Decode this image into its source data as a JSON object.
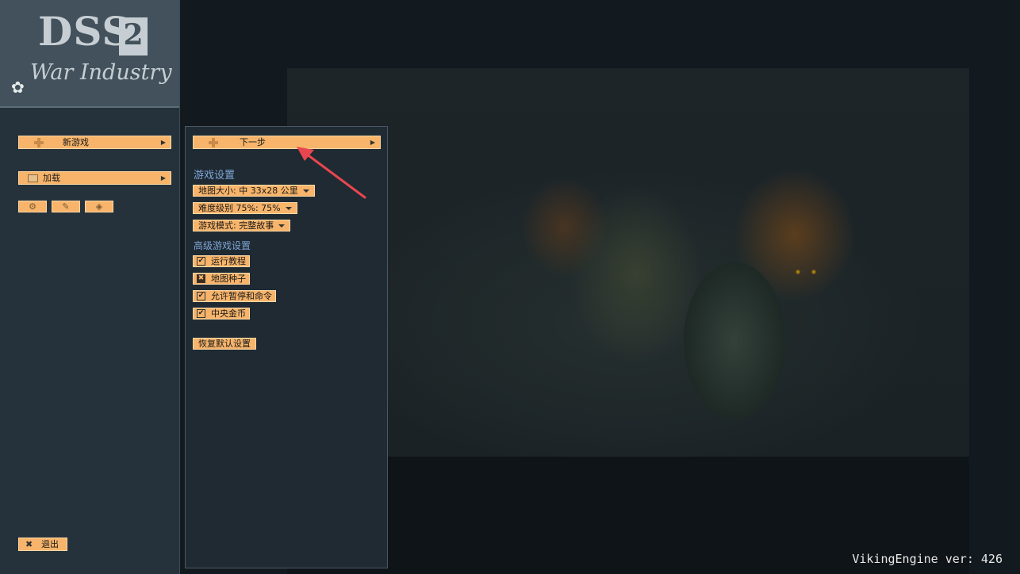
{
  "logo": {
    "line1": "DSS",
    "badge": "2",
    "line2": "War Industry"
  },
  "left_menu": {
    "new_game": "新游戏",
    "load": "加载",
    "quit": "退出",
    "small_buttons": [
      "gear-icon",
      "edit-icon",
      "diamond-icon"
    ]
  },
  "settings": {
    "next": "下一步",
    "game_settings_heading": "游戏设置",
    "map_size": "地图大小: 中 33x28 公里",
    "difficulty": "难度级别 75%: 75%",
    "game_mode": "游戏模式: 完整故事",
    "advanced_heading": "高级游戏设置",
    "tutorial": {
      "label": "运行教程",
      "checked": true
    },
    "map_seed": {
      "label": "地图种子",
      "checked": false
    },
    "allow_pause": {
      "label": "允许暂停和命令",
      "checked": true
    },
    "central_gold": {
      "label": "中央金币",
      "checked": true
    },
    "restore_defaults": "恢复默认设置"
  },
  "version": "VikingEngine ver: 426",
  "colors": {
    "button": "#f7b46a",
    "panel": "#1f2a33",
    "heading": "#7fa6d6",
    "annotation_arrow": "#e8464e"
  }
}
